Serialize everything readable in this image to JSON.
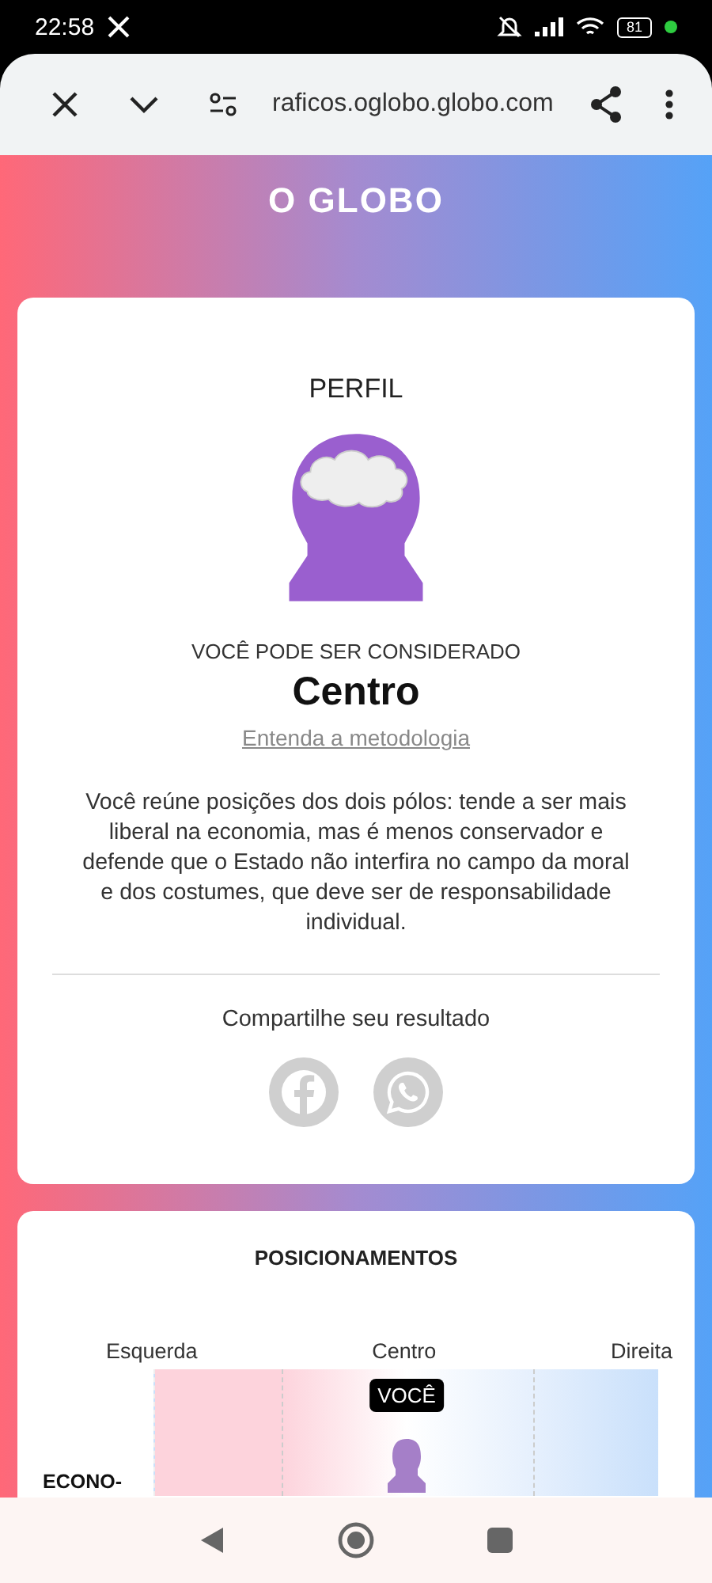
{
  "status_bar": {
    "time": "22:58",
    "battery": "81"
  },
  "browser": {
    "url": "raficos.oglobo.globo.com"
  },
  "logo": "O GLOBO",
  "profile": {
    "title": "PERFIL",
    "kicker": "VOCÊ PODE SER CONSIDERADO",
    "result": "Centro",
    "link": "Entenda a metodologia",
    "description": "Você reúne posições dos dois pólos: tende a ser mais liberal na economia, mas é menos conservador e defende que o Estado não interfira no campo da moral e dos costumes, que deve ser de responsabilidade individual.",
    "share_label": "Compartilhe seu resultado",
    "share_buttons": [
      {
        "kind": "facebook"
      },
      {
        "kind": "whatsapp"
      }
    ]
  },
  "positions": {
    "title": "POSICIONAMENTOS",
    "scale": [
      "Esquerda",
      "Centro",
      "Direita"
    ],
    "rows": [
      {
        "label": "ECONO-",
        "marker": "VOCÊ",
        "level": 0.5
      }
    ]
  }
}
